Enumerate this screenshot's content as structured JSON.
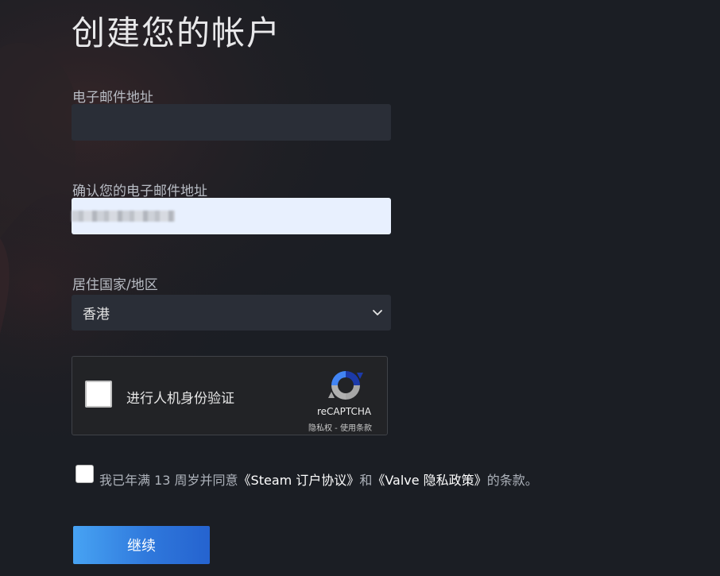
{
  "page": {
    "title": "创建您的帐户"
  },
  "email": {
    "label": "电子邮件地址",
    "value": ""
  },
  "confirm_email": {
    "label": "确认您的电子邮件地址"
  },
  "country": {
    "label": "居住国家/地区",
    "selected": "香港",
    "icon": "chevron-down-icon"
  },
  "captcha": {
    "label": "进行人机身份验证",
    "brand": "reCAPTCHA",
    "links": "隐私权 - 使用条款",
    "icon": "recaptcha-logo-icon"
  },
  "agreement": {
    "prefix": "我已年满 13 周岁并同意",
    "link1": "《Steam 订户协议》",
    "middle": "和",
    "link2": "《Valve 隐私政策》",
    "suffix": "的条款。"
  },
  "actions": {
    "continue_label": "继续"
  },
  "colors": {
    "background": "#1b1e24",
    "input_bg": "#2a2e37",
    "autofill_bg": "#e8f0fe",
    "button_start": "#47a3f3",
    "button_end": "#2563cf"
  }
}
